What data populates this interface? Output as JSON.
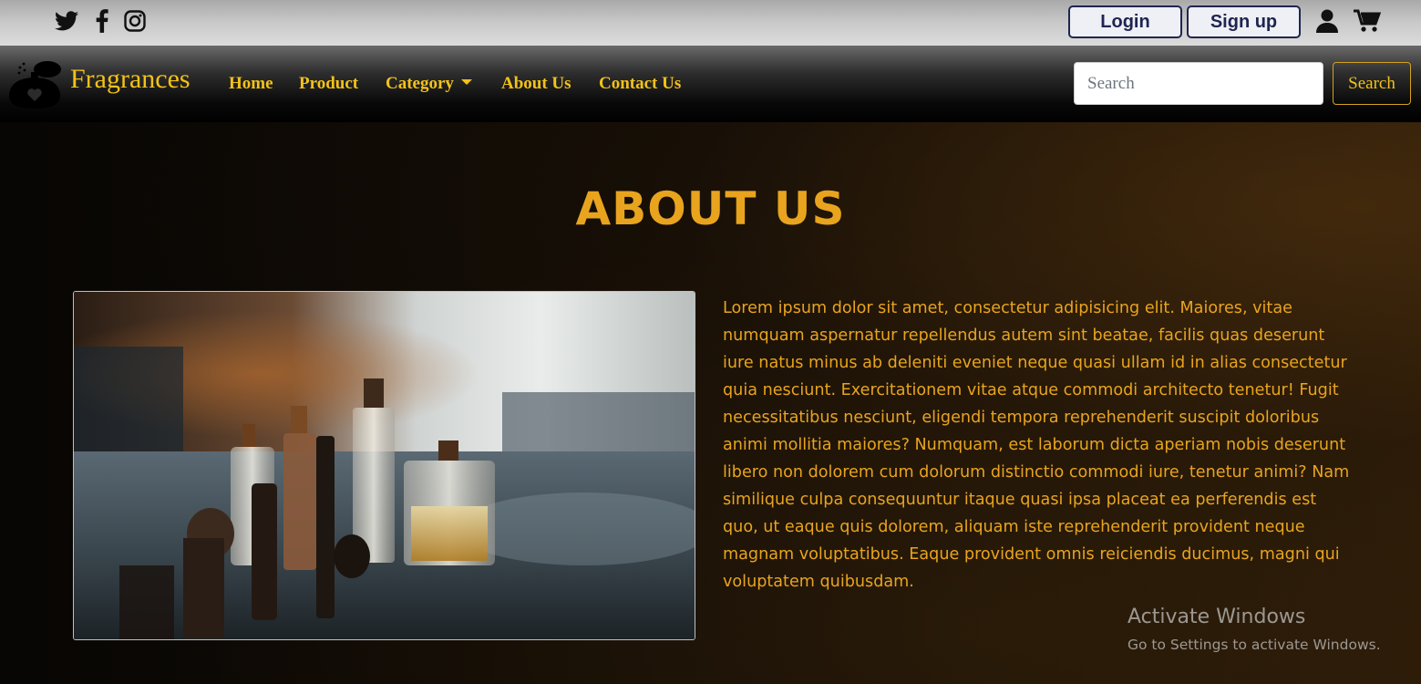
{
  "topbar": {
    "social_icons": [
      "twitter-icon",
      "facebook-icon",
      "instagram-icon"
    ],
    "login_label": "Login",
    "signup_label": "Sign up",
    "account_icon": "user-icon",
    "cart_icon": "cart-icon"
  },
  "navbar": {
    "brand": {
      "icon": "perfume-bottle-icon",
      "name": "Fragrances"
    },
    "links": [
      {
        "label": "Home"
      },
      {
        "label": "Product"
      },
      {
        "label": "Category",
        "has_dropdown": true
      },
      {
        "label": "About Us"
      },
      {
        "label": "Contact Us"
      }
    ],
    "search": {
      "placeholder": "Search",
      "button_label": "Search"
    }
  },
  "main": {
    "title": "ABOUT US",
    "image_icon": "perfume-bottles-photo",
    "paragraph": "Lorem ipsum dolor sit amet, consectetur adipisicing elit. Maiores, vitae numquam aspernatur repellendus autem sint beatae, facilis quas deserunt iure natus minus ab deleniti eveniet neque quasi ullam id in alias consectetur quia nesciunt. Exercitationem vitae atque commodi architecto tenetur! Fugit necessitatibus nesciunt, eligendi tempora reprehenderit suscipit doloribus animi mollitia maiores? Numquam, est laborum dicta aperiam nobis deserunt libero non dolorem cum dolorum distinctio commodi iure, tenetur animi? Nam similique culpa consequuntur itaque quasi ipsa placeat ea perferendis est quo, ut eaque quis dolorem, aliquam iste reprehenderit provident neque magnam voluptatibus. Eaque provident omnis reiciendis ducimus, magni qui voluptatem quibusdam."
  },
  "watermark": {
    "title": "Activate Windows",
    "subtitle": "Go to Settings to activate Windows."
  },
  "colors": {
    "accent": "#f3c21a",
    "about_text": "#e8a41e",
    "auth_button_border": "#1f2550"
  }
}
